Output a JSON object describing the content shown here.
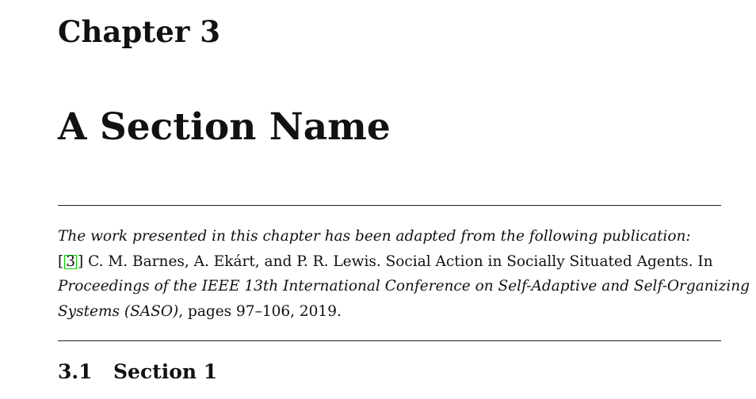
{
  "chapter": {
    "label": "Chapter 3",
    "title": "A Section Name"
  },
  "publication_note": {
    "intro": "The work presented in this chapter has been adapted from the following publication:",
    "citation_open": "[",
    "citation_number": "3",
    "citation_close": "]",
    "authors_and_title": " C. M. Barnes, A. Ekárt, and P. R. Lewis. Social Action in Socially Situated Agents. In",
    "venue_line1": "Proceedings of the IEEE 13th International Conference on Self-Adaptive and Self-Organizing",
    "venue_line2": "Systems (SASO)",
    "pages_year": ", pages 97–106, 2019."
  },
  "section": {
    "number": "3.1",
    "title": "Section 1"
  },
  "colors": {
    "text": "#111111",
    "citation_link_border": "#00d000"
  }
}
